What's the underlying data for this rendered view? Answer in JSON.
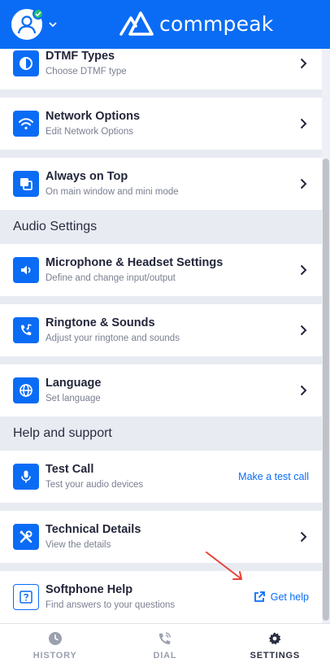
{
  "header": {
    "brand_name": "commpeak",
    "status": "online",
    "colors": {
      "header_bg": "#0a6cf5",
      "status_green": "#21c26b"
    }
  },
  "settings": {
    "rows_top": [
      {
        "title": "DTMF Types",
        "subtitle": "Choose DTMF type",
        "icon": "contrast-icon"
      },
      {
        "title": "Network Options",
        "subtitle": "Edit Network Options",
        "icon": "wifi-icon"
      },
      {
        "title": "Always on Top",
        "subtitle": "On main window and mini mode",
        "icon": "layers-icon"
      }
    ],
    "audio_section": "Audio Settings",
    "audio_rows": [
      {
        "title": "Microphone & Headset Settings",
        "subtitle": "Define and change input/output",
        "icon": "speaker-icon"
      },
      {
        "title": "Ringtone & Sounds",
        "subtitle": "Adjust your ringtone and sounds",
        "icon": "phone-music-icon"
      },
      {
        "title": "Language",
        "subtitle": "Set language",
        "icon": "globe-icon"
      }
    ],
    "help_section": "Help and support",
    "help_rows": [
      {
        "title": "Test Call",
        "subtitle": "Test your audio devices",
        "icon": "microphone-icon",
        "action": "Make a test call"
      },
      {
        "title": "Technical Details",
        "subtitle": "View the details",
        "icon": "tools-icon"
      },
      {
        "title": "Softphone Help",
        "subtitle": "Find answers to your questions",
        "icon": "question-icon",
        "action": "Get help"
      }
    ]
  },
  "bottom_nav": {
    "items": [
      {
        "label": "HISTORY",
        "icon": "clock-icon"
      },
      {
        "label": "DIAL",
        "icon": "phone-ring-icon"
      },
      {
        "label": "SETTINGS",
        "icon": "gear-icon"
      }
    ],
    "active": "SETTINGS"
  }
}
